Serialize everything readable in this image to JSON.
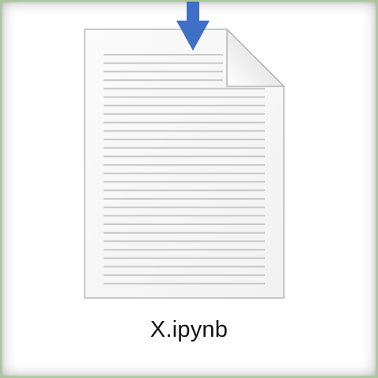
{
  "file": {
    "name": "X.ipynb",
    "icon": "blank-document-icon"
  },
  "indicator": {
    "icon": "down-arrow-icon",
    "color": "#3f6fc6"
  },
  "colors": {
    "frame_border": "#a9c89a",
    "page_fill": "#f7f7f7",
    "page_border": "#b9b9b9",
    "line_color": "#c8c8c8"
  }
}
